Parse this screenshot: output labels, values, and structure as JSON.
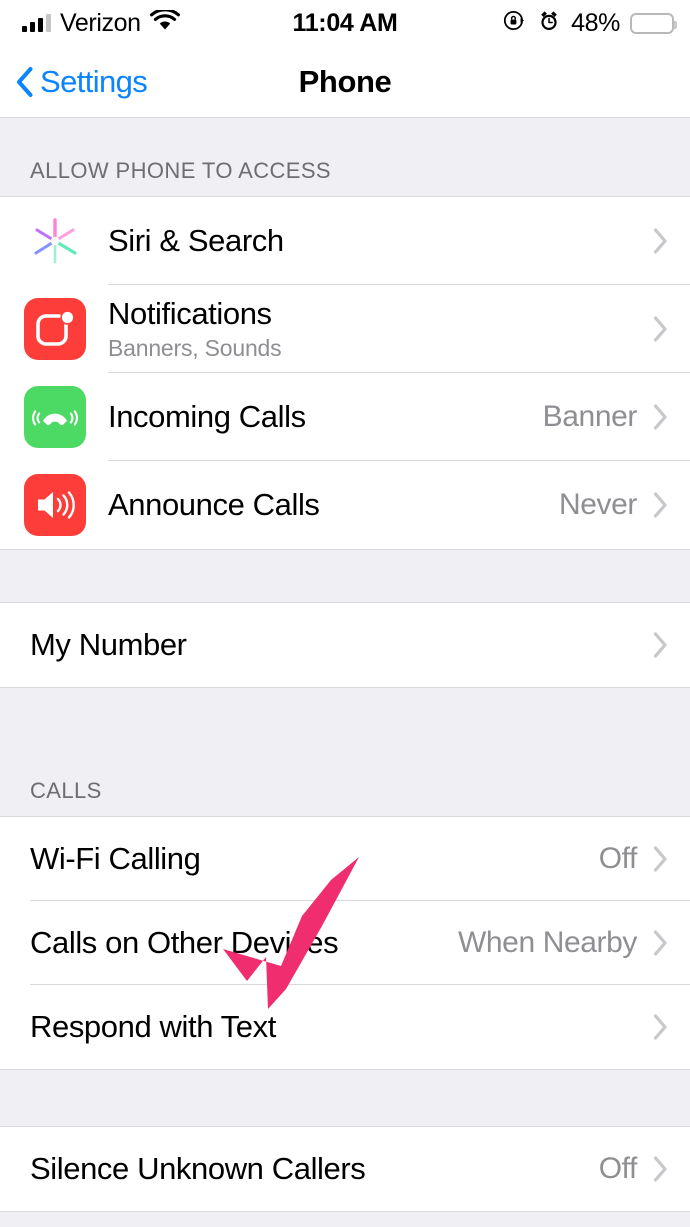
{
  "status_bar": {
    "carrier": "Verizon",
    "wifi_icon": "wifi-icon",
    "signal_icon": "cellular-signal-icon",
    "time": "11:04 AM",
    "rotation_lock_icon": "rotation-lock-icon",
    "alarm_icon": "alarm-clock-icon",
    "battery_percent": "48%",
    "battery_level": 48,
    "battery_color": "#FDCB1B"
  },
  "nav": {
    "back_label": "Settings",
    "back_icon": "chevron-left-icon",
    "title": "Phone",
    "tint_color": "#0A84FF"
  },
  "sections": [
    {
      "header": "ALLOW PHONE TO ACCESS",
      "rows": [
        {
          "label": "Siri & Search",
          "sub": "",
          "value": "",
          "icon": "siri-icon"
        },
        {
          "label": "Notifications",
          "sub": "Banners, Sounds",
          "value": "",
          "icon": "notifications-icon"
        },
        {
          "label": "Incoming Calls",
          "sub": "",
          "value": "Banner",
          "icon": "incoming-calls-icon"
        },
        {
          "label": "Announce Calls",
          "sub": "",
          "value": "Never",
          "icon": "announce-calls-icon"
        }
      ]
    },
    {
      "header": "",
      "rows": [
        {
          "label": "My Number",
          "sub": "",
          "value": "",
          "icon": ""
        }
      ]
    },
    {
      "header": "CALLS",
      "rows": [
        {
          "label": "Wi-Fi Calling",
          "sub": "",
          "value": "Off",
          "icon": ""
        },
        {
          "label": "Calls on Other Devices",
          "sub": "",
          "value": "When Nearby",
          "icon": ""
        },
        {
          "label": "Respond with Text",
          "sub": "",
          "value": "",
          "icon": ""
        }
      ]
    },
    {
      "header": "",
      "rows": [
        {
          "label": "Silence Unknown Callers",
          "sub": "",
          "value": "Off",
          "icon": ""
        }
      ]
    }
  ],
  "annotation": {
    "type": "arrow",
    "color": "#F02D6E",
    "points_to": "Respond with Text"
  },
  "colors": {
    "group_background": "#FFFFFF",
    "page_background": "#EFEFF4",
    "separator": "#D9D9DD",
    "secondary_text": "#8E8E93",
    "chevron": "#C7C7CC"
  }
}
